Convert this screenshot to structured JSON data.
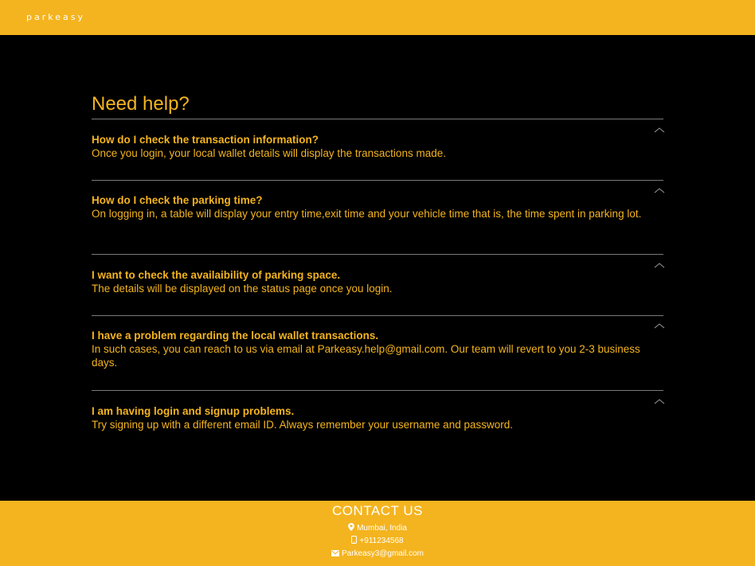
{
  "header": {
    "brand": "parkeasy",
    "background_color": "#f4b41f"
  },
  "main": {
    "title": "Need help?",
    "accent_color": "#f4b41f",
    "faqs": [
      {
        "question": "How do I check the transaction information?",
        "answer": "Once you login, your local wallet details will display the transactions made.",
        "icon": "chevron-up-icon"
      },
      {
        "question": "How do I check the parking time?",
        "answer": "On logging in, a table will display your entry time,exit time and your vehicle time that is, the time spent in parking lot.",
        "icon": "chevron-up-icon"
      },
      {
        "question": "I want to check the availaibility of parking space.",
        "answer": "The details will be displayed on the status page once you login.",
        "icon": "chevron-up-icon"
      },
      {
        "question": "I have a problem regarding the local wallet transactions.",
        "answer": "In such cases, you can reach to us via email at Parkeasy.help@gmail.com. Our team will revert to you 2-3 business days.",
        "icon": "chevron-up-icon"
      },
      {
        "question": "I am having login and signup problems.",
        "answer": "Try signing up with a different email ID. Always remember your username and password.",
        "icon": "chevron-up-icon"
      }
    ]
  },
  "footer": {
    "title": "CONTACT US",
    "location": "Mumbai, India",
    "location_icon": "map-marker-icon",
    "phone": "+911234568",
    "phone_icon": "mobile-phone-icon",
    "email": "Parkeasy3@gmail.com",
    "email_icon": "envelope-icon"
  }
}
